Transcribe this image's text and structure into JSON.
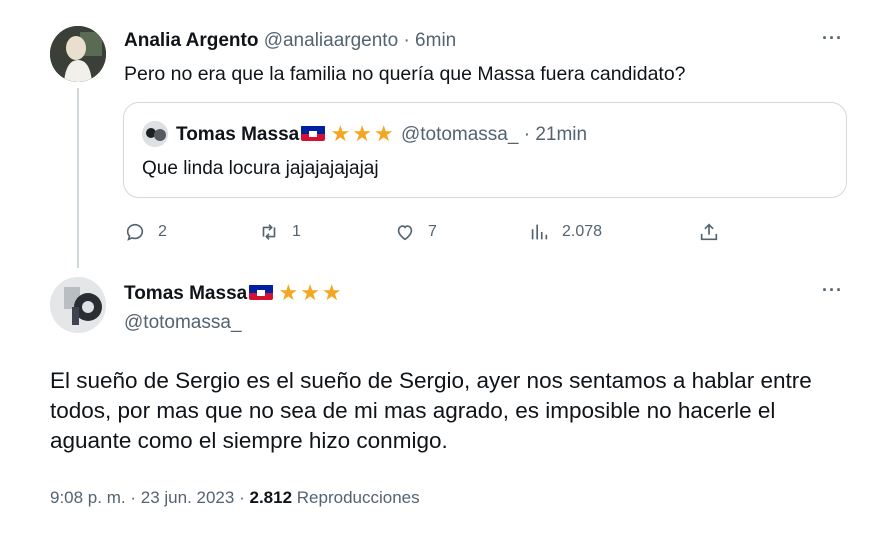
{
  "tweet": {
    "author_name": "Analia Argento",
    "handle": "@analiaargento",
    "sep": "·",
    "time": "6min",
    "text": "Pero no era que la familia no quería que Massa fuera candidato?",
    "quote": {
      "author_name": "Tomas Massa",
      "stars": "★★★",
      "handle": "@totomassa_",
      "sep": "·",
      "time": "21min",
      "text": "Que linda locura jajajajajajaj"
    },
    "actions": {
      "replies": "2",
      "retweets": "1",
      "likes": "7",
      "views": "2.078"
    }
  },
  "reply": {
    "author_name": "Tomas Massa",
    "stars": "★★★",
    "handle": "@totomassa_",
    "text": "El sueño de Sergio es el sueño de Sergio, ayer nos sentamos a hablar entre todos, por mas que no sea de mi mas agrado, es imposible no hacerle el aguante como el siempre hizo conmigo.",
    "time": "9:08 p. m.",
    "date": "23 jun. 2023",
    "sep": "·",
    "views_count": "2.812",
    "views_label": "Reproducciones"
  },
  "more_label": "···",
  "icons": [
    "reply-icon",
    "retweet-icon",
    "like-icon",
    "views-icon",
    "share-icon",
    "more-icon",
    "haiti-flag-icon",
    "star-icon"
  ],
  "colors": {
    "text": "#0f1419",
    "muted": "#536471",
    "border": "#cfd9de",
    "star": "#f4a623"
  }
}
